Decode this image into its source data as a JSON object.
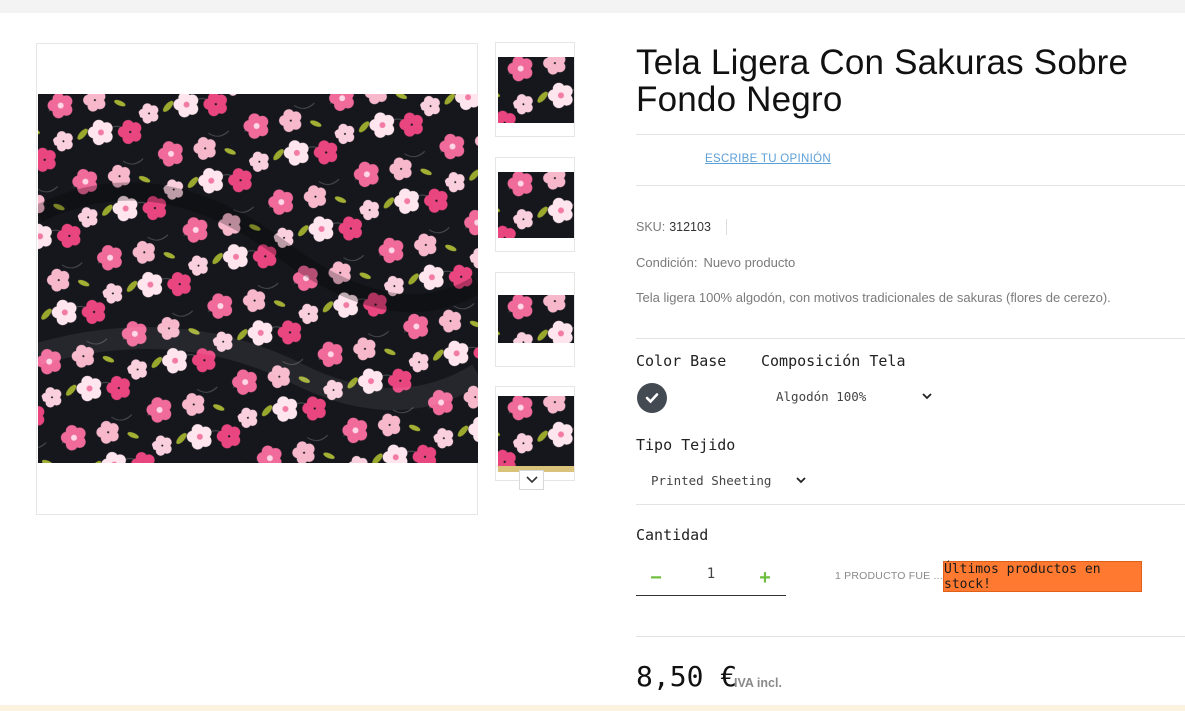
{
  "product": {
    "title_line1": "Tela Ligera Con Sakuras Sobre",
    "title_line2": "Fondo Negro",
    "review_link": "ESCRIBE TU OPINIÓN",
    "sku_label": "SKU:",
    "sku_value": "312103",
    "condition_label": "Condición:",
    "condition_value": "Nuevo producto",
    "description": "Tela ligera 100% algodón, con motivos tradicionales de sakuras (flores de cerezo)."
  },
  "variants": {
    "color_label": "Color Base",
    "color_swatch_hex": "#444a52",
    "composition_label": "Composición Tela",
    "composition_selected": "Algodón 100%",
    "weave_label": "Tipo Tejido",
    "weave_selected": "Printed Sheeting"
  },
  "quantity": {
    "label": "Cantidad",
    "value": "1",
    "minus": "−",
    "plus": "+"
  },
  "stock": {
    "note": "1 PRODUCTO FUE ...",
    "badge": "Últimos productos en stock!",
    "badge_color": "#ff7a30"
  },
  "pricing": {
    "price": "8,50 €",
    "tax": "IVA incl."
  },
  "gallery": {
    "thumbnail_count": 4,
    "nav_icon": "chevron-down-icon"
  }
}
